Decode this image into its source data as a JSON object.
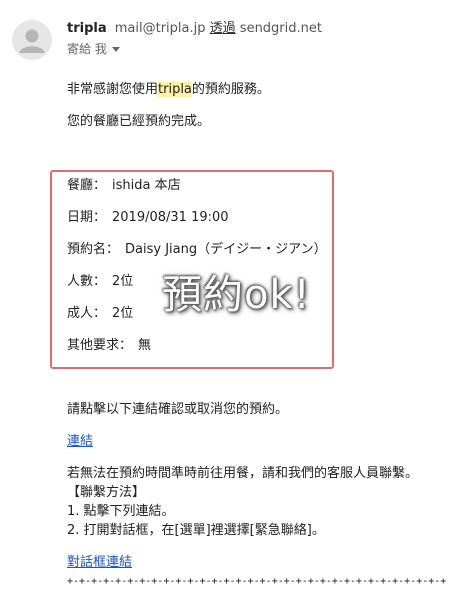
{
  "header": {
    "sender_name": "tripla",
    "sender_email": "mail@tripla.jp",
    "via_label": "透過",
    "via_domain": "sendgrid.net",
    "to_label": "寄給 我"
  },
  "body": {
    "greeting_before": "非常感謝您使用",
    "greeting_highlight": "tripla",
    "greeting_after": "的預約服務。",
    "completion": "您的餐廳已經預約完成。"
  },
  "reservation": {
    "restaurant_label": "餐廳：",
    "restaurant_value": "ishida 本店",
    "date_label": "日期：",
    "date_value": "2019/08/31 19:00",
    "name_label": "預約名：",
    "name_value": "Daisy Jiang（デイジー・ジアン）",
    "people_label": "人數：",
    "people_value": "2位",
    "adults_label": "成人：",
    "adults_value": "2位",
    "other_label": "其他要求：",
    "other_value": "無"
  },
  "overlay": {
    "stamp_text": "預約ok!"
  },
  "footer": {
    "instruction": "請點擊以下連結確認或取消您的預約。",
    "link_label": "連結",
    "contact_text": "若無法在預約時間準時前往用餐，請和我們的客服人員聯繫。",
    "contact_method": "【聯繫方法】",
    "step1": "1. 點擊下列連結。",
    "step2": "2. 打開對話框，在[選單]裡選擇[緊急聯絡]。",
    "chat_link_label": "對話框連結",
    "divider": "+-+-+-+-+-+-+-+-+-+-+-+-+-+-+-+-+-+-+-+-+-+-+-+-+-+-+-+-+-+-+-+-+-+-+-+-+-+-+-+-+-+-+-+"
  },
  "colors": {
    "highlight": "#fff3a3",
    "box_border": "#e46b6b",
    "link": "#1a55cc"
  }
}
